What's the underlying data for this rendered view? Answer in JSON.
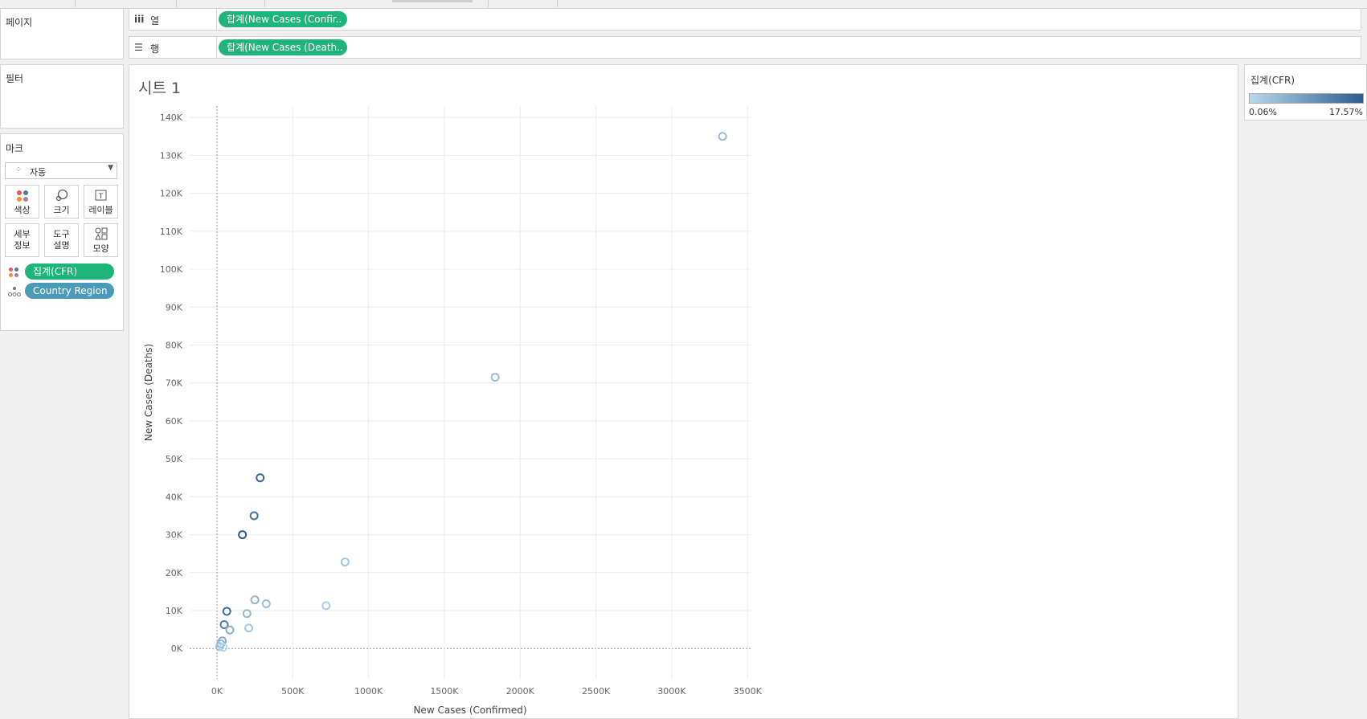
{
  "shelves": {
    "pages_title": "페이지",
    "columns": {
      "icon": "iii",
      "label": "열",
      "pill": "합계(New Cases (Confir.."
    },
    "rows": {
      "icon": "☰",
      "label": "행",
      "pill": "합계(New Cases (Death.."
    }
  },
  "filters": {
    "title": "필터"
  },
  "marks": {
    "title": "마크",
    "type_select": "자동",
    "buttons": {
      "color": "색상",
      "size": "크기",
      "label": "레이블",
      "detail": "세부\n정보",
      "tooltip": "도구\n설명",
      "shape": "모양"
    },
    "fields": [
      {
        "label": "집계(CFR)",
        "icon": "color-dots-icon",
        "color": "#1fb47a"
      },
      {
        "label": "Country Region",
        "icon": "detail-icon",
        "color": "#4a9bb8"
      }
    ]
  },
  "sheet": {
    "title": "시트 1"
  },
  "legend": {
    "title": "집계(CFR)",
    "min_label": "0.06%",
    "max_label": "17.57%",
    "color_low": "#b7d8ee",
    "color_high": "#2c5d8f"
  },
  "chart_data": {
    "type": "scatter",
    "xlabel": "New Cases (Confirmed)",
    "ylabel": "New Cases (Deaths)",
    "xlim": [
      -180000,
      3520000
    ],
    "ylim": [
      -8000,
      143000
    ],
    "x_ticks": [
      "0K",
      "500K",
      "1000K",
      "1500K",
      "2000K",
      "2500K",
      "3000K",
      "3500K"
    ],
    "x_tick_values": [
      0,
      500000,
      1000000,
      1500000,
      2000000,
      2500000,
      3000000,
      3500000
    ],
    "y_ticks": [
      "0K",
      "10K",
      "20K",
      "30K",
      "40K",
      "50K",
      "60K",
      "70K",
      "80K",
      "90K",
      "100K",
      "110K",
      "120K",
      "130K",
      "140K"
    ],
    "y_tick_values": [
      0,
      10000,
      20000,
      30000,
      40000,
      50000,
      60000,
      70000,
      80000,
      90000,
      100000,
      110000,
      120000,
      130000,
      140000
    ],
    "grid": true,
    "marker": "hollow-circle",
    "points": [
      {
        "x": 3335000,
        "y": 135000,
        "cfr": 0.04
      },
      {
        "x": 1835000,
        "y": 71500,
        "cfr": 0.039
      },
      {
        "x": 845000,
        "y": 22800,
        "cfr": 0.027
      },
      {
        "x": 720000,
        "y": 11300,
        "cfr": 0.016
      },
      {
        "x": 325000,
        "y": 11800,
        "cfr": 0.036
      },
      {
        "x": 285000,
        "y": 45000,
        "cfr": 0.158
      },
      {
        "x": 245000,
        "y": 35000,
        "cfr": 0.143
      },
      {
        "x": 168000,
        "y": 30000,
        "cfr": 0.1757
      },
      {
        "x": 250000,
        "y": 12800,
        "cfr": 0.051
      },
      {
        "x": 198000,
        "y": 9200,
        "cfr": 0.046
      },
      {
        "x": 210000,
        "y": 5400,
        "cfr": 0.026
      },
      {
        "x": 65000,
        "y": 9800,
        "cfr": 0.15
      },
      {
        "x": 48000,
        "y": 6300,
        "cfr": 0.13
      },
      {
        "x": 85000,
        "y": 4900,
        "cfr": 0.06
      },
      {
        "x": 35000,
        "y": 2000,
        "cfr": 0.06
      },
      {
        "x": 25000,
        "y": 1200,
        "cfr": 0.05
      },
      {
        "x": 18000,
        "y": 500,
        "cfr": 0.03
      },
      {
        "x": 42000,
        "y": 300,
        "cfr": 0.0006
      }
    ]
  }
}
